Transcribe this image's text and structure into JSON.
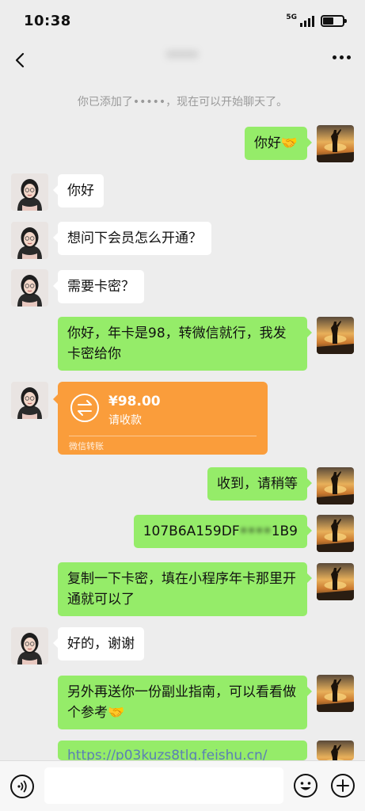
{
  "status_bar": {
    "time": "10:38",
    "network": "5G"
  },
  "header": {
    "title": "••••"
  },
  "system_message": "你已添加了•••••，现在可以开始聊天了。",
  "messages": [
    {
      "side": "right",
      "text": "你好🤝"
    },
    {
      "side": "left",
      "text": "你好"
    },
    {
      "side": "left",
      "text": "想问下会员怎么开通？"
    },
    {
      "side": "left",
      "text": "需要卡密？"
    },
    {
      "side": "right",
      "text": "你好，年卡是98，转微信就行，我发卡密给你"
    },
    {
      "side": "right",
      "text": "收到，请稍等"
    },
    {
      "side": "right",
      "text_visible": "107B6A159DF",
      "text_redacted": "••••",
      "text_end": "1B9"
    },
    {
      "side": "right",
      "text": "复制一下卡密，填在小程序年卡那里开通就可以了"
    },
    {
      "side": "left",
      "text": "好的，谢谢"
    },
    {
      "side": "right",
      "text": "另外再送你一份副业指南，可以看看做个参考🤝"
    },
    {
      "side": "right",
      "text": "https://p03kuzs8tlq.feishu.cn/"
    }
  ],
  "transfer": {
    "amount": "¥98.00",
    "status": "请收款",
    "label": "微信转账"
  },
  "input_bar": {
    "placeholder": ""
  },
  "icons": {
    "back": "chevron-left-icon",
    "more": "more-dots-icon",
    "voice": "voice-icon",
    "emoji": "emoji-icon",
    "plus": "plus-icon",
    "transfer": "transfer-arrows-icon"
  },
  "colors": {
    "background": "#ededed",
    "bubble_self": "#95ec69",
    "bubble_other": "#ffffff",
    "transfer": "#fa9d3b"
  }
}
